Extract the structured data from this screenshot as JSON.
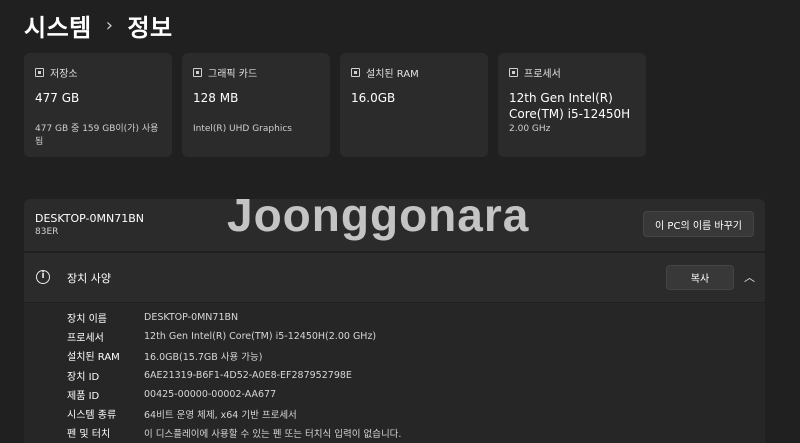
{
  "breadcrumb": {
    "parent": "시스템",
    "separator": "›",
    "current": "정보"
  },
  "cards": [
    {
      "icon": "storage-icon",
      "title": "저장소",
      "value": "477 GB",
      "sub": "477 GB 중 159 GB이(가) 사용됨"
    },
    {
      "icon": "graphics-card-icon",
      "title": "그래픽 카드",
      "value": "128 MB",
      "sub": "Intel(R) UHD Graphics"
    },
    {
      "icon": "ram-icon",
      "title": "설치된 RAM",
      "value": "16.0GB",
      "sub": ""
    },
    {
      "icon": "processor-icon",
      "title": "프로세서",
      "value": "12th Gen Intel(R) Core(TM) i5-12450H",
      "sub": "2.00 GHz"
    }
  ],
  "device": {
    "name": "DESKTOP-0MN71BN",
    "model": "83ER",
    "rename_label": "이 PC의 이름 바꾸기"
  },
  "specs_section": {
    "title": "장치 사양",
    "copy_label": "복사",
    "rows": [
      {
        "label": "장치 이름",
        "value": "DESKTOP-0MN71BN"
      },
      {
        "label": "프로세서",
        "value": "12th Gen Intel(R) Core(TM) i5-12450H(2.00 GHz)"
      },
      {
        "label": "설치된 RAM",
        "value": "16.0GB(15.7GB 사용 가능)"
      },
      {
        "label": "장치 ID",
        "value": "6AE21319-B6F1-4D52-A0E8-EF287952798E"
      },
      {
        "label": "제품 ID",
        "value": "00425-00000-00002-AA677"
      },
      {
        "label": "시스템 종류",
        "value": "64비트 운영 체제, x64 기반 프로세서"
      },
      {
        "label": "펜 및 터치",
        "value": "이 디스플레이에 사용할 수 있는 펜 또는 터치식 입력이 없습니다."
      }
    ]
  },
  "watermark": "Joonggonara"
}
